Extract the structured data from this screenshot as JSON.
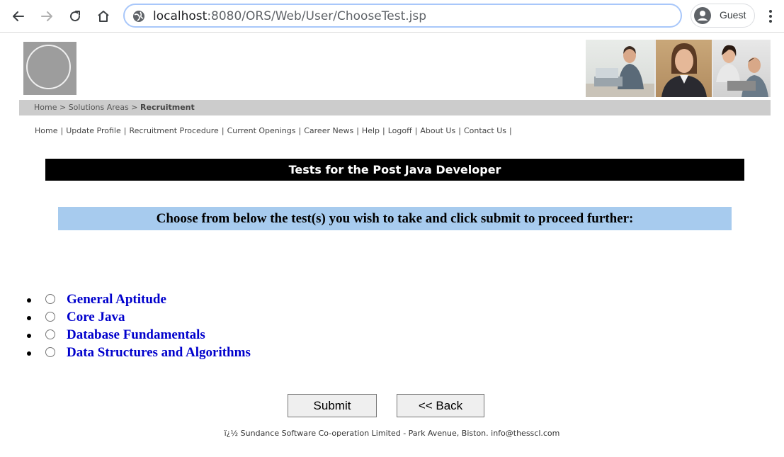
{
  "browser": {
    "url_host": "localhost",
    "url_rest": ":8080/ORS/Web/User/ChooseTest.jsp",
    "profile_label": "Guest",
    "icons": [
      "back-icon",
      "forward-icon",
      "reload-icon",
      "home-icon",
      "globe-icon",
      "avatar-icon",
      "more-vert-icon"
    ]
  },
  "breadcrumb": {
    "home": "Home",
    "sep": ">",
    "solutions": "Solutions Areas",
    "current": "Recruitment"
  },
  "menu": {
    "items": [
      "Home",
      "Update Profile",
      "Recruitment Procedure",
      "Current Openings",
      "Career News",
      "Help",
      "Logoff",
      "About Us",
      "Contact Us"
    ],
    "sep": "|"
  },
  "page": {
    "title": "Tests for the Post Java Developer",
    "instruction": "Choose from below the test(s) you wish to take and click submit to proceed further:"
  },
  "tests": [
    "General Aptitude",
    "Core Java",
    "Database Fundamentals",
    "Data Structures and Algorithms"
  ],
  "buttons": {
    "submit": "Submit",
    "back": "<< Back"
  },
  "footer": "ï¿½ Sundance Software Co-operation Limited - Park Avenue, Biston. info@thesscl.com",
  "colors": {
    "title_bg": "#000000",
    "instruction_bg": "#a7cbee",
    "test_link": "#0000cc",
    "crumb_bg": "#cccccc"
  }
}
